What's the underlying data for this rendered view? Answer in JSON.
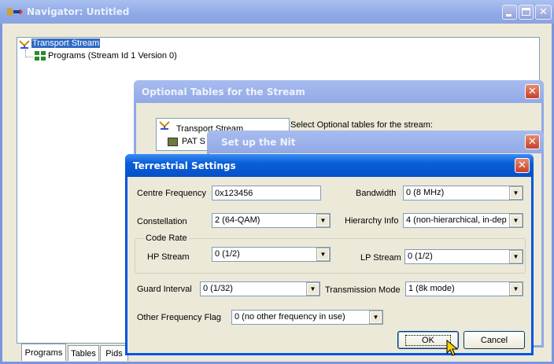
{
  "navigator": {
    "title": "Navigator: Untitled",
    "tree": {
      "root": "Transport Stream",
      "child": "Programs (Stream Id 1 Version 0)"
    },
    "tabs": [
      "Programs",
      "Tables",
      "Pids"
    ],
    "colors": {
      "titlebar_inactive": "#9db5e8",
      "frame": "#7a96df"
    }
  },
  "optional_tables": {
    "title": "Optional Tables for the Stream",
    "tree_root": "Transport Stream",
    "tree_child": "PAT S",
    "instruction": "Select Optional tables for the stream:"
  },
  "nit": {
    "title": "Set up the Nit"
  },
  "terrestrial": {
    "title": "Terrestrial Settings",
    "centre_frequency": {
      "label": "Centre Frequency",
      "value": "0x123456"
    },
    "bandwidth": {
      "label": "Bandwidth",
      "value": "0 (8 MHz)"
    },
    "constellation": {
      "label": "Constellation",
      "value": "2 (64-QAM)"
    },
    "hierarchy": {
      "label": "Hierarchy Info",
      "value": "4 (non-hierarchical, in-dep"
    },
    "code_rate": {
      "group_label": "Code Rate",
      "hp_label": "HP Stream",
      "hp_value": "0 (1/2)",
      "lp_label": "LP Stream",
      "lp_value": "0 (1/2)"
    },
    "guard_interval": {
      "label": "Guard Interval",
      "value": "0 (1/32)"
    },
    "transmission_mode": {
      "label": "Transmission Mode",
      "value": "1 (8k mode)"
    },
    "other_frequency": {
      "label": "Other Frequency Flag",
      "value": "0 (no other frequency in use)"
    },
    "ok_label": "OK",
    "cancel_label": "Cancel",
    "colors": {
      "titlebar_active": "#0a5fd8",
      "frame": "#0054e3",
      "body": "#ece9d8"
    }
  }
}
